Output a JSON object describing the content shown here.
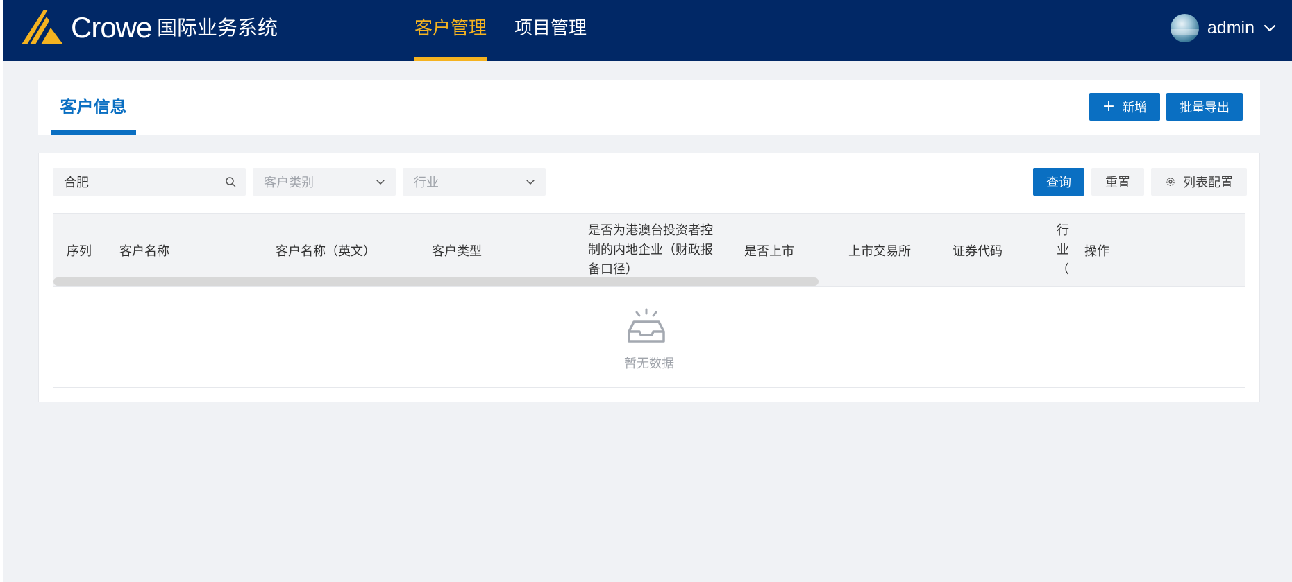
{
  "header": {
    "logo_word": "Crowe",
    "system_name": "国际业务系统",
    "nav": [
      {
        "label": "客户管理",
        "active": true
      },
      {
        "label": "项目管理",
        "active": false
      }
    ],
    "user": {
      "name": "admin"
    }
  },
  "page": {
    "tab_title": "客户信息",
    "add_button": "新增",
    "export_button": "批量导出"
  },
  "filters": {
    "search_value": "合肥",
    "customer_category_placeholder": "客户类别",
    "industry_placeholder": "行业",
    "query_button": "查询",
    "reset_button": "重置",
    "column_config_button": "列表配置"
  },
  "table": {
    "columns": [
      "序列",
      "客户名称",
      "客户名称（英文）",
      "客户类型",
      "是否为港澳台投资者控制的内地企业（财政报备口径）",
      "是否上市",
      "上市交易所",
      "证券代码",
      "行业（",
      "操作"
    ],
    "rows": [],
    "empty_text": "暂无数据"
  },
  "colors": {
    "header_bg": "#012866",
    "accent_gold": "#f5b320",
    "primary_blue": "#0a6fc2",
    "page_bg": "#f0f2f5"
  }
}
